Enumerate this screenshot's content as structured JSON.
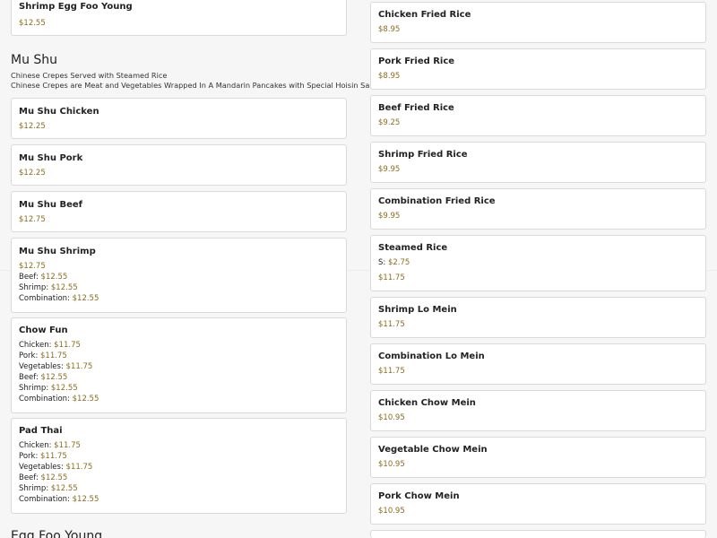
{
  "left": {
    "top_item": {
      "name": "Shrimp Egg Foo Young",
      "price": "$12.55"
    },
    "mushu": {
      "title": "Mu Shu",
      "desc1": "Chinese Crepes Served with Steamed Rice",
      "desc2": "Chinese Crepes are Meat and Vegetables Wrapped In A Mandarin Pancakes with Special Hoisin Sauce",
      "items": [
        {
          "name": "Mu Shu Chicken",
          "price": "$12.25"
        },
        {
          "name": "Mu Shu Pork",
          "price": "$12.25"
        },
        {
          "name": "Mu Shu Beef",
          "price": "$12.75"
        }
      ],
      "shrimp": {
        "name": "Mu Shu Shrimp",
        "price": "$12.75",
        "lines": [
          {
            "label": "Beef:",
            "price": "$12.55"
          },
          {
            "label": "Shrimp:",
            "price": "$12.55"
          },
          {
            "label": "Combination:",
            "price": "$12.55"
          }
        ]
      }
    },
    "chow_fun": {
      "name": "Chow Fun",
      "lines": [
        {
          "label": "Chicken:",
          "price": "$11.75"
        },
        {
          "label": "Pork:",
          "price": "$11.75"
        },
        {
          "label": "Vegetables:",
          "price": "$11.75"
        },
        {
          "label": "Beef:",
          "price": "$12.55"
        },
        {
          "label": "Shrimp:",
          "price": "$12.55"
        },
        {
          "label": "Combination:",
          "price": "$12.55"
        }
      ]
    },
    "pad_thai": {
      "name": "Pad Thai",
      "lines": [
        {
          "label": "Chicken:",
          "price": "$11.75"
        },
        {
          "label": "Pork:",
          "price": "$11.75"
        },
        {
          "label": "Vegetables:",
          "price": "$11.75"
        },
        {
          "label": "Beef:",
          "price": "$12.55"
        },
        {
          "label": "Shrimp:",
          "price": "$12.55"
        },
        {
          "label": "Combination:",
          "price": "$12.55"
        }
      ]
    },
    "next_section": "Egg Foo Young"
  },
  "right": {
    "items": [
      {
        "name": "Chicken Fried Rice",
        "price": "$8.95"
      },
      {
        "name": "Pork Fried Rice",
        "price": "$8.95"
      },
      {
        "name": "Beef Fried Rice",
        "price": "$9.25"
      },
      {
        "name": "Shrimp Fried Rice",
        "price": "$9.95"
      },
      {
        "name": "Combination Fried Rice",
        "price": "$9.95"
      }
    ],
    "steamed_rice": {
      "name": "Steamed Rice",
      "small_label": "S:",
      "small_price": "$2.75",
      "price": "$11.75"
    },
    "items2": [
      {
        "name": "Shrimp Lo Mein",
        "price": "$11.75"
      },
      {
        "name": "Combination Lo Mein",
        "price": "$11.75"
      },
      {
        "name": "Chicken Chow Mein",
        "price": "$10.95"
      },
      {
        "name": "Vegetable Chow Mein",
        "price": "$10.95"
      },
      {
        "name": "Pork Chow Mein",
        "price": "$10.95"
      }
    ]
  }
}
